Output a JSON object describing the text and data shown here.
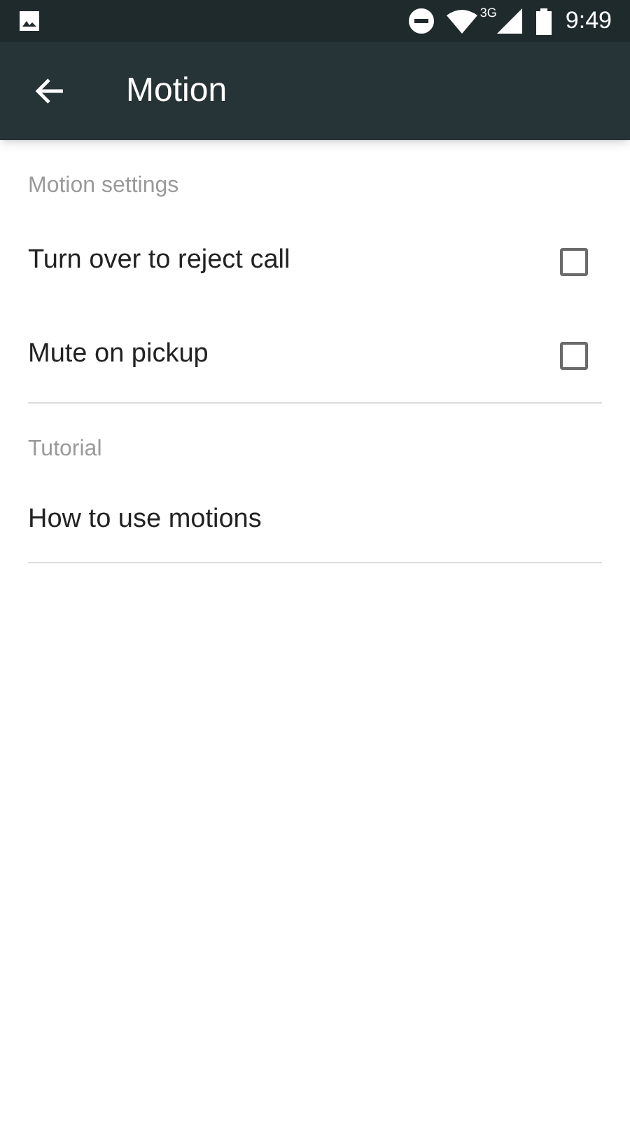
{
  "status_bar": {
    "network": "3G",
    "time": "9:49"
  },
  "toolbar": {
    "title": "Motion"
  },
  "sections": [
    {
      "header": "Motion settings",
      "items": [
        {
          "kind": "checkbox",
          "label": "Turn over to reject call",
          "checked": false
        },
        {
          "kind": "checkbox",
          "label": "Mute on pickup",
          "checked": false
        }
      ]
    },
    {
      "header": "Tutorial",
      "items": [
        {
          "kind": "link",
          "label": "How to use motions"
        }
      ]
    }
  ]
}
